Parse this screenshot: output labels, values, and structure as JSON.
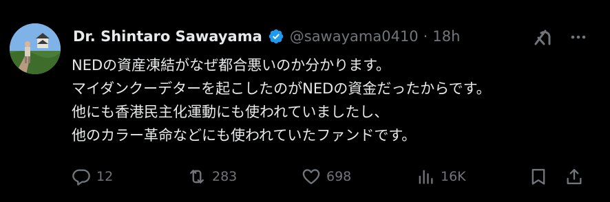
{
  "author": {
    "display_name": "Dr. Shintaro Sawayama",
    "handle": "@sawayama0410",
    "separator": "·",
    "time": "18h",
    "verified": true,
    "verified_color": "#1d9bf0"
  },
  "tweet": {
    "lines": [
      "NEDの資産凍結がなぜ都合悪いのか分かります。",
      "マイダンクーデターを起こしたのがNEDの資金だったからです。",
      "他にも香港民主化運動にも使われていましたし、",
      "他のカラー革命などにも使われていたファンドです。"
    ]
  },
  "actions": {
    "reply": {
      "icon": "reply-icon",
      "count": "12"
    },
    "retweet": {
      "icon": "retweet-icon",
      "count": "283"
    },
    "like": {
      "icon": "heart-icon",
      "count": "698"
    },
    "views": {
      "icon": "analytics-icon",
      "count": "16K"
    },
    "bookmark": {
      "icon": "bookmark-icon"
    },
    "share": {
      "icon": "share-icon"
    }
  },
  "header_icons": {
    "grok": "grok-icon",
    "more": "more-icon"
  },
  "colors": {
    "background": "#000000",
    "text_primary": "#e7e9ea",
    "text_secondary": "#71767b",
    "accent": "#1d9bf0"
  }
}
